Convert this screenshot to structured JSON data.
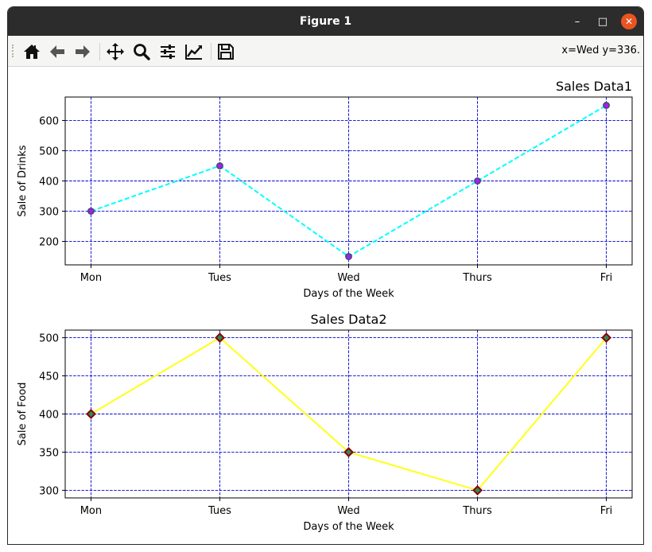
{
  "window": {
    "title": "Figure 1",
    "min_glyph": "–",
    "max_glyph": "□",
    "close_glyph": "✕"
  },
  "toolbar": {
    "buttons": [
      "home-icon",
      "back-icon",
      "forward-icon",
      "pan-icon",
      "zoom-icon",
      "configure-subplots-icon",
      "edit-axis-icon",
      "save-icon"
    ],
    "coords": "x=Wed y=336."
  },
  "chart_data": [
    {
      "type": "line",
      "title": "Sales Data1",
      "title_loc": "right",
      "xlabel": "Days of the Week",
      "ylabel": "Sale of Drinks",
      "categories": [
        "Mon",
        "Tues",
        "Wed",
        "Thurs",
        "Fri"
      ],
      "series": [
        {
          "values": [
            300,
            450,
            150,
            400,
            650
          ],
          "color": "#00ffff",
          "linestyle": "dashed",
          "marker": "circle",
          "marker_face": "#a020f0",
          "marker_edge": "#2f4f4f"
        }
      ],
      "ylim": [
        122.5,
        677.5
      ],
      "yticks": [
        200,
        300,
        400,
        500,
        600
      ],
      "grid": true,
      "grid_color": "#0000cd",
      "grid_style": "dashed"
    },
    {
      "type": "line",
      "title": "Sales Data2",
      "title_loc": "center",
      "xlabel": "Days of the Week",
      "ylabel": "Sale of Food",
      "categories": [
        "Mon",
        "Tues",
        "Wed",
        "Thurs",
        "Fri"
      ],
      "series": [
        {
          "values": [
            400,
            500,
            350,
            300,
            500
          ],
          "color": "#ffff1a",
          "linestyle": "solid",
          "marker": "diamond",
          "marker_face": "#2e8b57",
          "marker_edge": "#8b0000"
        }
      ],
      "ylim": [
        290,
        510
      ],
      "yticks": [
        300,
        350,
        400,
        450,
        500
      ],
      "grid": true,
      "grid_color": "#0000cd",
      "grid_style": "dashed"
    }
  ]
}
